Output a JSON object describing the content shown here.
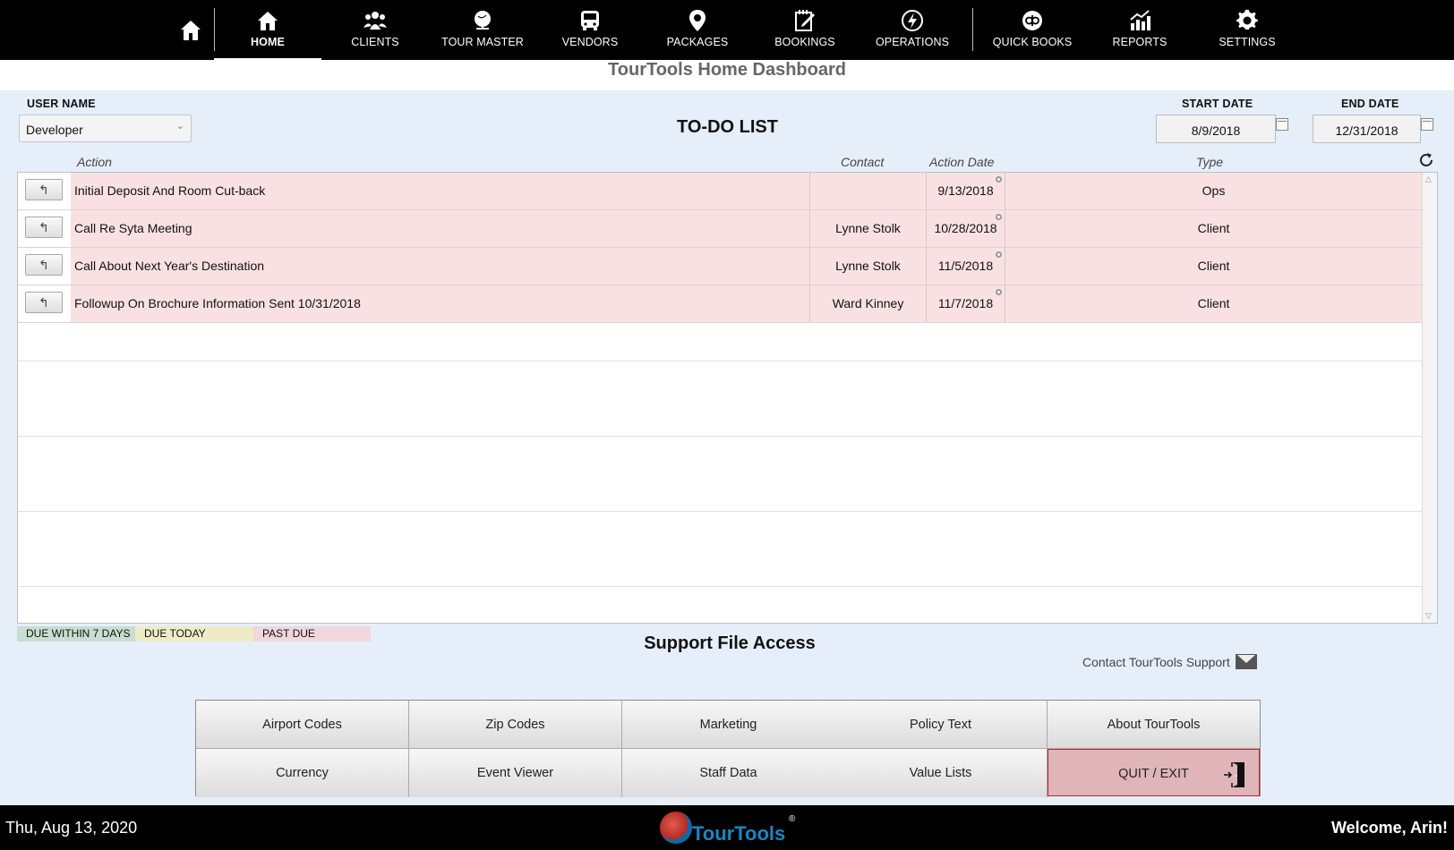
{
  "nav": {
    "items": [
      {
        "id": "home",
        "label": "HOME",
        "icon": "house-icon"
      },
      {
        "id": "clients",
        "label": "CLIENTS",
        "icon": "people-icon"
      },
      {
        "id": "tour_master",
        "label": "TOUR MASTER",
        "icon": "globe-icon"
      },
      {
        "id": "vendors",
        "label": "VENDORS",
        "icon": "bus-icon"
      },
      {
        "id": "packages",
        "label": "PACKAGES",
        "icon": "map-pin-icon"
      },
      {
        "id": "bookings",
        "label": "BOOKINGS",
        "icon": "notepad-icon"
      },
      {
        "id": "operations",
        "label": "OPERATIONS",
        "icon": "lightning-icon"
      },
      {
        "id": "quick_books",
        "label": "QUICK BOOKS",
        "icon": "quickbooks-icon"
      },
      {
        "id": "reports",
        "label": "REPORTS",
        "icon": "chart-icon"
      },
      {
        "id": "settings",
        "label": "SETTINGS",
        "icon": "gear-icon"
      }
    ]
  },
  "page_title": "TourTools Home Dashboard",
  "user": {
    "label": "USER NAME",
    "value": "Developer"
  },
  "start_date": {
    "label": "START DATE",
    "value": "8/9/2018"
  },
  "end_date": {
    "label": "END DATE",
    "value": "12/31/2018"
  },
  "todo": {
    "title": "TO-DO LIST",
    "columns": {
      "action": "Action",
      "contact": "Contact",
      "action_date": "Action Date",
      "type": "Type"
    },
    "rows": [
      {
        "action": "Initial Deposit And Room Cut-back",
        "contact": "",
        "date": "9/13/2018",
        "type": "Ops"
      },
      {
        "action": "Call Re Syta Meeting",
        "contact": "Lynne Stolk",
        "date": "10/28/2018",
        "type": "Client"
      },
      {
        "action": "Call About Next Year's Destination",
        "contact": "Lynne Stolk",
        "date": "11/5/2018",
        "type": "Client"
      },
      {
        "action": "Followup On Brochure Information Sent 10/31/2018",
        "contact": "Ward Kinney",
        "date": "11/7/2018",
        "type": "Client"
      }
    ]
  },
  "legend": [
    {
      "label": "DUE WITHIN 7 DAYS",
      "color": "#c6dfd0"
    },
    {
      "label": "DUE TODAY",
      "color": "#eeecc8"
    },
    {
      "label": "PAST DUE",
      "color": "#f2d6dd"
    }
  ],
  "support": {
    "title": "Support File Access",
    "contact_label": "Contact TourTools Support",
    "buttons": [
      "Airport Codes",
      "Zip Codes",
      "Marketing",
      "Policy Text",
      "About TourTools",
      "Currency",
      "Event Viewer",
      "Staff Data",
      "Value Lists",
      "QUIT / EXIT"
    ]
  },
  "footer": {
    "date": "Thu, Aug 13, 2020",
    "logo_text": "TourTools",
    "registered": "®",
    "welcome": "Welcome, Arin!"
  }
}
